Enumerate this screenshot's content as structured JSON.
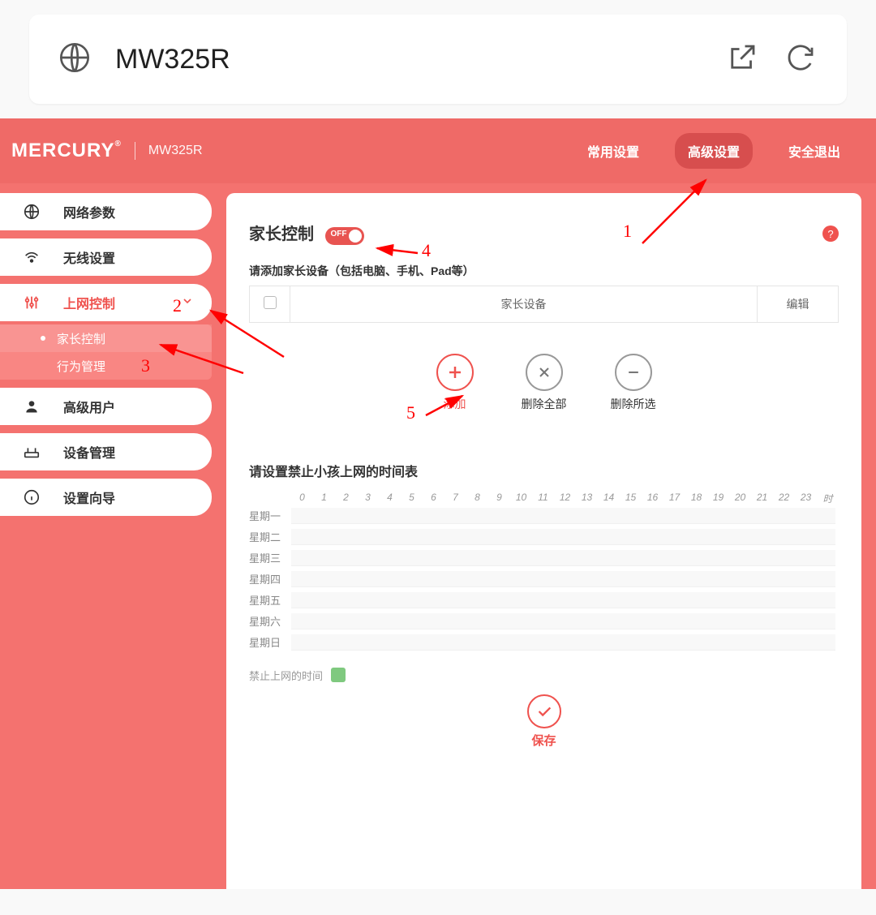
{
  "addressBar": {
    "title": "MW325R"
  },
  "header": {
    "brand": "MERCURY",
    "model": "MW325R",
    "nav": {
      "common": "常用设置",
      "advanced": "高级设置",
      "logout": "安全退出"
    }
  },
  "sidebar": {
    "items": {
      "network": "网络参数",
      "wireless": "无线设置",
      "access": "上网控制",
      "advUser": "高级用户",
      "device": "设备管理",
      "wizard": "设置向导"
    },
    "sub": {
      "parental": "家长控制",
      "behavior": "行为管理"
    }
  },
  "panel": {
    "title": "家长控制",
    "toggleText": "OFF",
    "addHint": "请添加家长设备（包括电脑、手机、Pad等）",
    "table": {
      "colDevice": "家长设备",
      "colEdit": "编辑"
    },
    "actions": {
      "add": "添加",
      "delAll": "删除全部",
      "delSel": "删除所选"
    },
    "schedTitle": "请设置禁止小孩上网的时间表",
    "hours": [
      "0",
      "1",
      "2",
      "3",
      "4",
      "5",
      "6",
      "7",
      "8",
      "9",
      "10",
      "11",
      "12",
      "13",
      "14",
      "15",
      "16",
      "17",
      "18",
      "19",
      "20",
      "21",
      "22",
      "23",
      "时"
    ],
    "days": [
      "星期一",
      "星期二",
      "星期三",
      "星期四",
      "星期五",
      "星期六",
      "星期日"
    ],
    "legend": "禁止上网的时间",
    "save": "保存"
  },
  "annotations": {
    "n1": "1",
    "n2": "2",
    "n3": "3",
    "n4": "4",
    "n5": "5"
  }
}
